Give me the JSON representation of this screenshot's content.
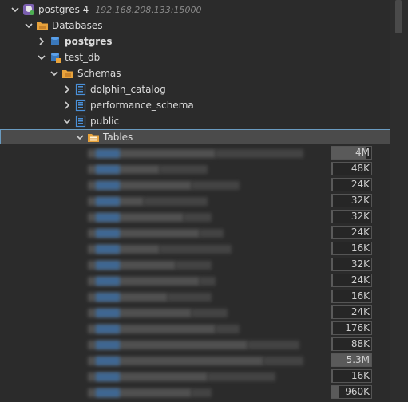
{
  "tree": {
    "connection": {
      "label": "postgres 4",
      "host": "192.168.208.133:15000"
    },
    "databases_label": "Databases",
    "db_postgres": "postgres",
    "db_test": "test_db",
    "schemas_label": "Schemas",
    "schema_dolphin": "dolphin_catalog",
    "schema_perf": "performance_schema",
    "schema_public": "public",
    "tables_label": "Tables"
  },
  "tables": [
    {
      "size": "4M",
      "fill": 0.85
    },
    {
      "size": "48K",
      "fill": 0.02
    },
    {
      "size": "24K",
      "fill": 0.01
    },
    {
      "size": "32K",
      "fill": 0.01
    },
    {
      "size": "32K",
      "fill": 0.01
    },
    {
      "size": "24K",
      "fill": 0.01
    },
    {
      "size": "16K",
      "fill": 0.01
    },
    {
      "size": "32K",
      "fill": 0.01
    },
    {
      "size": "24K",
      "fill": 0.01
    },
    {
      "size": "16K",
      "fill": 0.01
    },
    {
      "size": "24K",
      "fill": 0.01
    },
    {
      "size": "176K",
      "fill": 0.04
    },
    {
      "size": "88K",
      "fill": 0.02
    },
    {
      "size": "5.3M",
      "fill": 1.0
    },
    {
      "size": "16K",
      "fill": 0.01
    },
    {
      "size": "960K",
      "fill": 0.18
    }
  ],
  "colors": {
    "background": "#2b2b2b",
    "selection": "#4b4b4b",
    "selection_border": "#6a9bc0",
    "db_icon": "#4a90d9",
    "folder_icon": "#e8a33c"
  }
}
